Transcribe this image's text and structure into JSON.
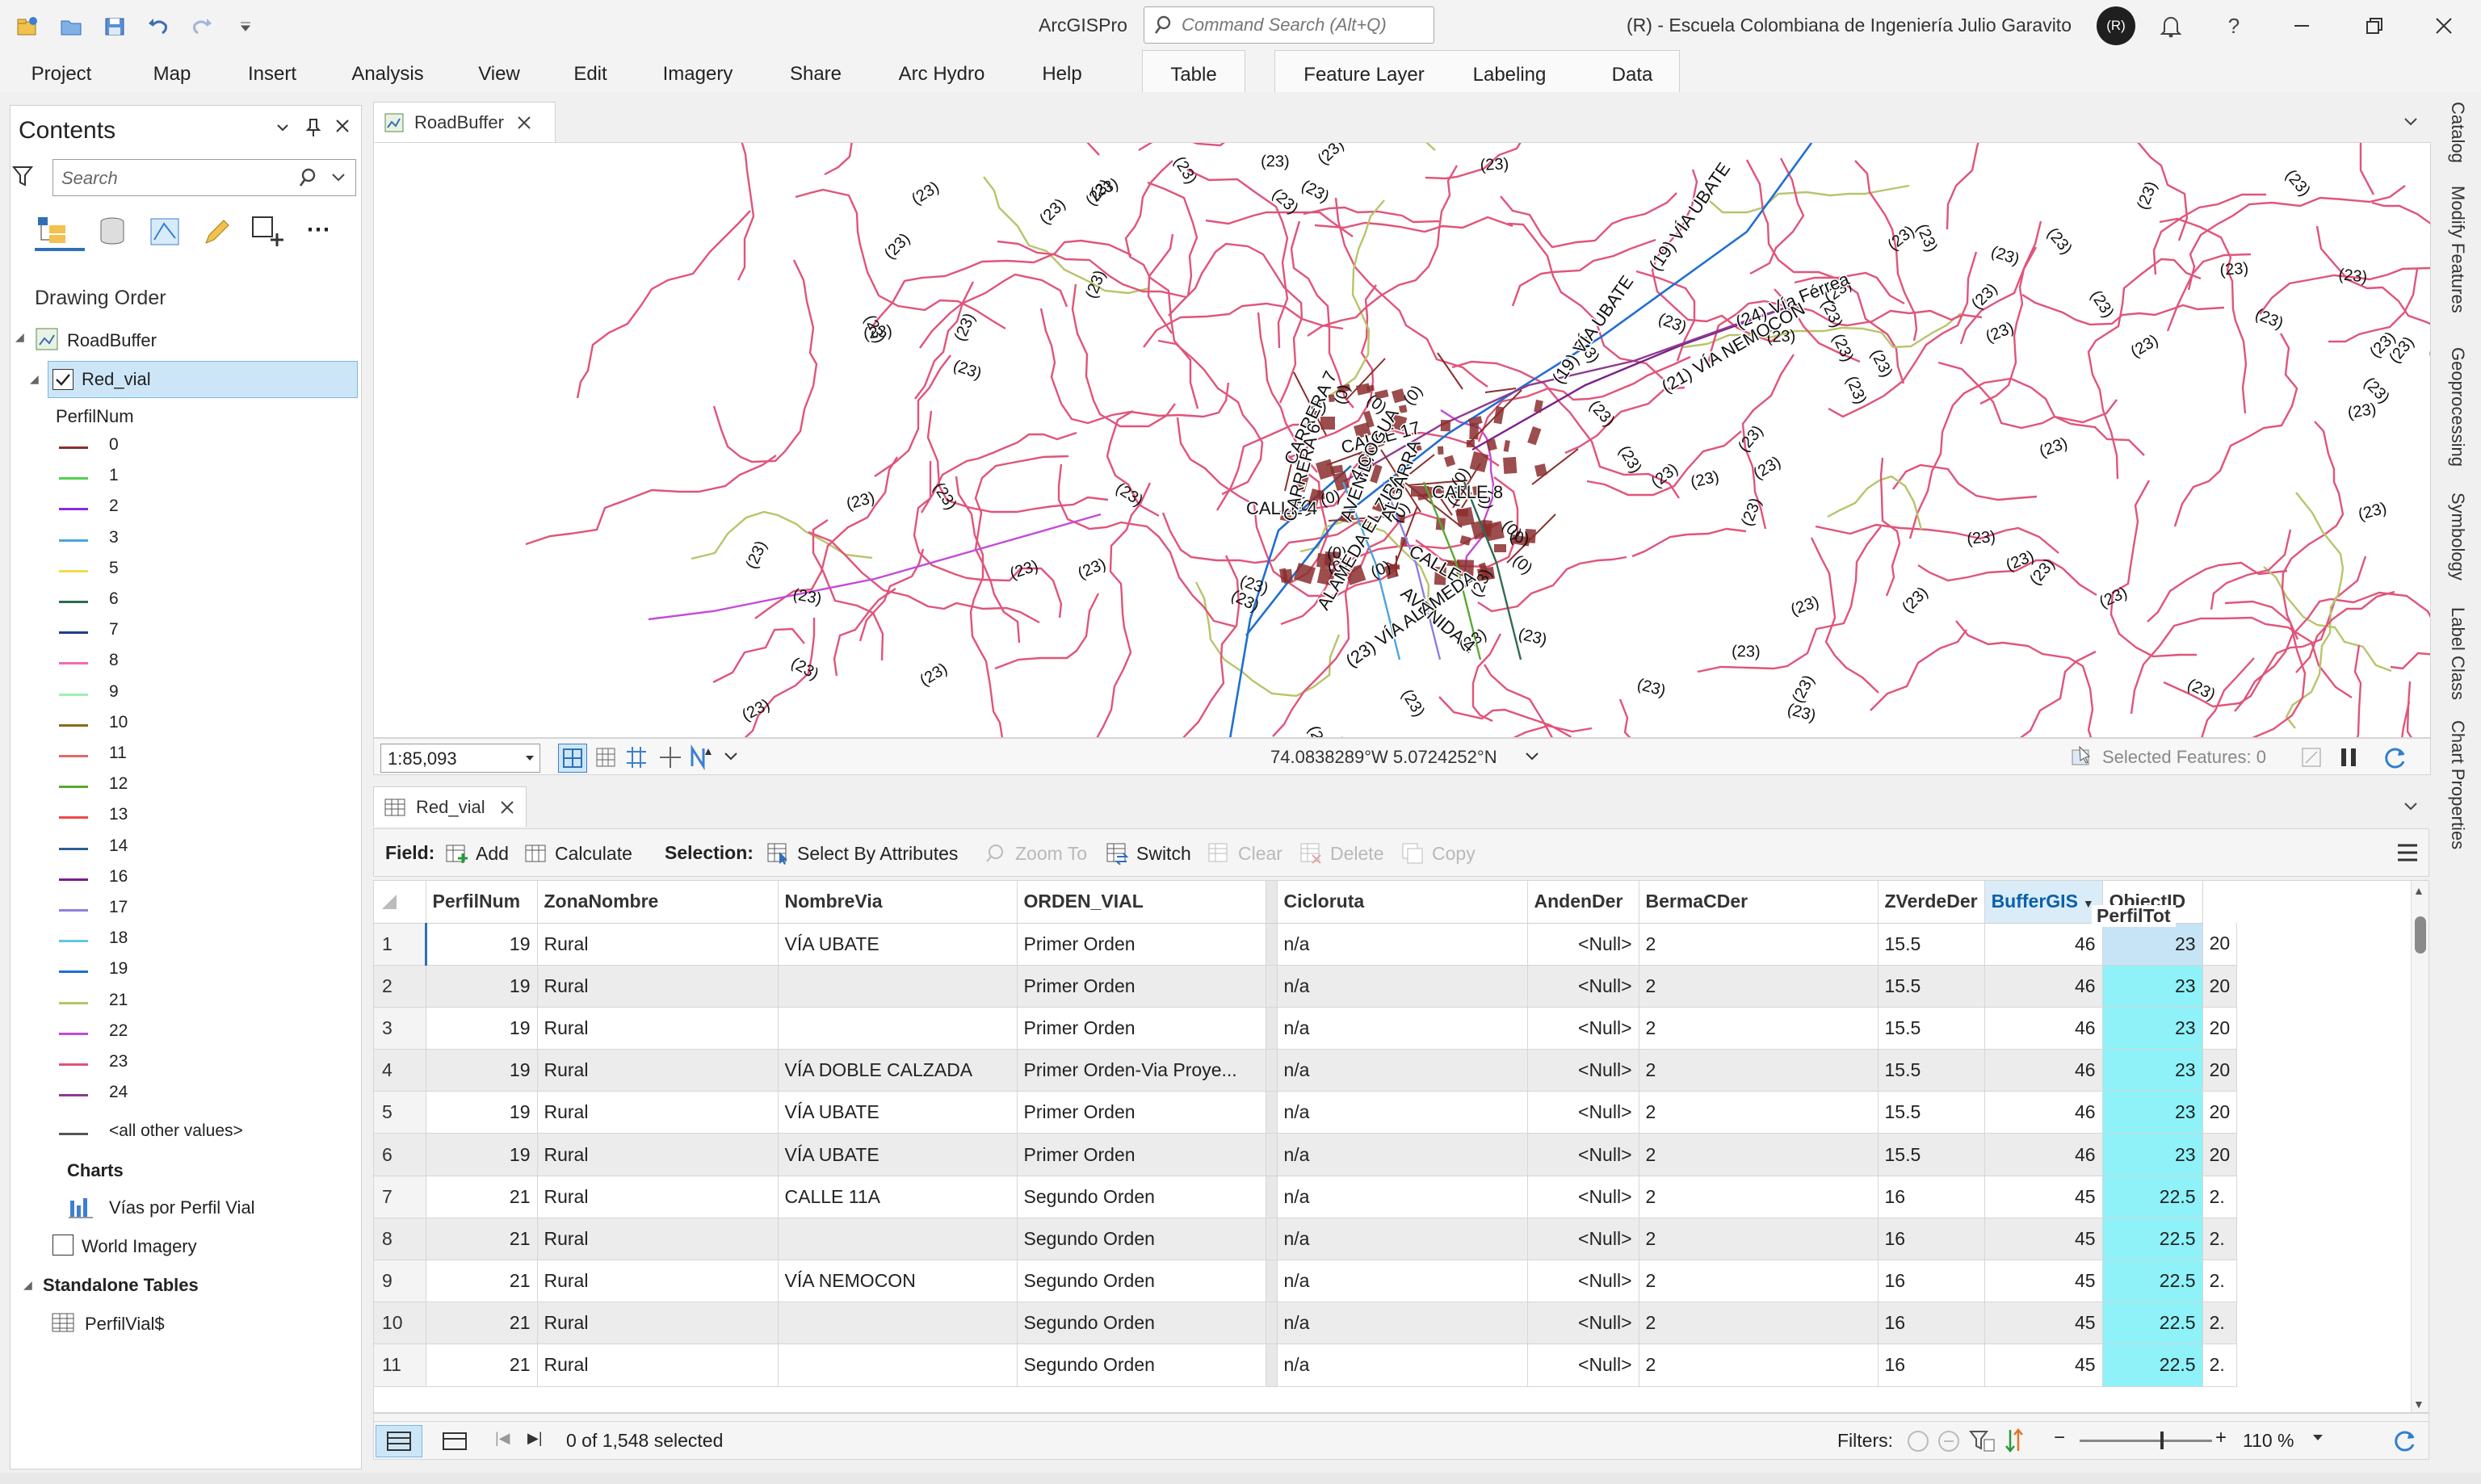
{
  "app": {
    "title": "ArcGISPro",
    "org": "(R) - Escuela Colombiana de Ingeniería Julio Garavito",
    "avatar": "(R)"
  },
  "command_search": {
    "placeholder": "Command Search (Alt+Q)"
  },
  "menu": [
    "Project",
    "Map",
    "Insert",
    "Analysis",
    "View",
    "Edit",
    "Imagery",
    "Share",
    "Arc Hydro",
    "Help"
  ],
  "context_tabs": {
    "group1": [
      "Table"
    ],
    "group2": [
      "Feature Layer",
      "Labeling",
      "Data"
    ]
  },
  "contents": {
    "title": "Contents",
    "search_placeholder": "Search",
    "drawing_order": "Drawing Order",
    "map_name": "RoadBuffer",
    "layer": "Red_vial",
    "field": "PerfilNum",
    "legend": [
      {
        "label": "0",
        "color": "#8b2e2e"
      },
      {
        "label": "1",
        "color": "#4fd14f"
      },
      {
        "label": "2",
        "color": "#8a2be2"
      },
      {
        "label": "3",
        "color": "#4aa3df"
      },
      {
        "label": "5",
        "color": "#f2d94e"
      },
      {
        "label": "6",
        "color": "#2e6b4f"
      },
      {
        "label": "7",
        "color": "#1e3d8f"
      },
      {
        "label": "8",
        "color": "#f06bb5"
      },
      {
        "label": "9",
        "color": "#9ef0b0"
      },
      {
        "label": "10",
        "color": "#8a6a1c"
      },
      {
        "label": "11",
        "color": "#e06a6a"
      },
      {
        "label": "12",
        "color": "#5aa832"
      },
      {
        "label": "13",
        "color": "#f04848"
      },
      {
        "label": "14",
        "color": "#2c5f8f"
      },
      {
        "label": "16",
        "color": "#7a1f8a"
      },
      {
        "label": "17",
        "color": "#8f7fe0"
      },
      {
        "label": "18",
        "color": "#5ec6e6"
      },
      {
        "label": "19",
        "color": "#1f6fd1"
      },
      {
        "label": "21",
        "color": "#b8c46a"
      },
      {
        "label": "22",
        "color": "#c44ad8"
      },
      {
        "label": "23",
        "color": "#e0547a"
      },
      {
        "label": "24",
        "color": "#8e3a8e"
      }
    ],
    "other_values": "<all other values>",
    "other_color": "#555555",
    "charts_heading": "Charts",
    "chart_item": "Vías por Perfil Vial",
    "world_imagery": "World Imagery",
    "standalone_heading": "Standalone Tables",
    "standalone_table": "PerfilVial$"
  },
  "map": {
    "tab": "RoadBuffer",
    "scale": "1:85,093",
    "coords": "74.0838289°W 5.0724252°N",
    "selected_features": "Selected Features: 0",
    "labels": [
      {
        "text": "(19) VÍA UBATE",
        "rot": -55
      },
      {
        "text": "(19) VÍA UBATE",
        "rot": -55
      },
      {
        "text": "(24) Vía Férrea",
        "rot": -22
      },
      {
        "text": "(21) VÍA NEMOCON",
        "rot": -30
      },
      {
        "text": "CARRERA 7",
        "rot": -65
      },
      {
        "text": "CALLE 17",
        "rot": -15
      },
      {
        "text": "CALLE 8",
        "rot": 0
      },
      {
        "text": "CALLE 4",
        "rot": 0
      },
      {
        "text": "CALLE 7",
        "rot": 30
      },
      {
        "text": "AVENIDA 4",
        "rot": 40
      },
      {
        "text": "ALAMEDA EL ZIPA",
        "rot": -60
      },
      {
        "text": "(23) VÍA ALAMEDA",
        "rot": -35
      },
      {
        "text": "ALGARRA",
        "rot": -70
      },
      {
        "text": "AVENIDA",
        "rot": -70
      },
      {
        "text": "CARRERA 6",
        "rot": -75
      },
      {
        "text": "4 COGUA",
        "rot": -60
      }
    ]
  },
  "table": {
    "tab": "Red_vial",
    "field_label": "Field:",
    "add": "Add",
    "calculate": "Calculate",
    "selection_label": "Selection:",
    "select_by_attributes": "Select By Attributes",
    "zoom_to": "Zoom To",
    "switch": "Switch",
    "clear": "Clear",
    "delete": "Delete",
    "copy": "Copy",
    "columns": [
      "PerfilNum",
      "ZonaNombre",
      "NombreVia",
      "ORDEN_VIAL",
      "Cicloruta",
      "AndenDer",
      "BermaCDer",
      "ZVerdeDer",
      "PerfilTot",
      "BufferGIS",
      "ObjectID"
    ],
    "rows": [
      [
        "1",
        "19",
        "Rural",
        "VÍA UBATE",
        "Primer Orden",
        "n/a",
        "<Null>",
        "2",
        "15.5",
        "46",
        "23",
        "20"
      ],
      [
        "2",
        "19",
        "Rural",
        "",
        "Primer Orden",
        "n/a",
        "<Null>",
        "2",
        "15.5",
        "46",
        "23",
        "20"
      ],
      [
        "3",
        "19",
        "Rural",
        "",
        "Primer Orden",
        "n/a",
        "<Null>",
        "2",
        "15.5",
        "46",
        "23",
        "20"
      ],
      [
        "4",
        "19",
        "Rural",
        "VÍA DOBLE CALZADA",
        "Primer Orden-Via Proye...",
        "n/a",
        "<Null>",
        "2",
        "15.5",
        "46",
        "23",
        "20"
      ],
      [
        "5",
        "19",
        "Rural",
        "VÍA UBATE",
        "Primer Orden",
        "n/a",
        "<Null>",
        "2",
        "15.5",
        "46",
        "23",
        "20"
      ],
      [
        "6",
        "19",
        "Rural",
        "VÍA UBATE",
        "Primer Orden",
        "n/a",
        "<Null>",
        "2",
        "15.5",
        "46",
        "23",
        "20"
      ],
      [
        "7",
        "21",
        "Rural",
        "CALLE 11A",
        "Segundo Orden",
        "n/a",
        "<Null>",
        "2",
        "16",
        "45",
        "22.5",
        "2."
      ],
      [
        "8",
        "21",
        "Rural",
        "",
        "Segundo Orden",
        "n/a",
        "<Null>",
        "2",
        "16",
        "45",
        "22.5",
        "2."
      ],
      [
        "9",
        "21",
        "Rural",
        "VÍA NEMOCON",
        "Segundo Orden",
        "n/a",
        "<Null>",
        "2",
        "16",
        "45",
        "22.5",
        "2."
      ],
      [
        "10",
        "21",
        "Rural",
        "",
        "Segundo Orden",
        "n/a",
        "<Null>",
        "2",
        "16",
        "45",
        "22.5",
        "2."
      ],
      [
        "11",
        "21",
        "Rural",
        "",
        "Segundo Orden",
        "n/a",
        "<Null>",
        "2",
        "16",
        "45",
        "22.5",
        "2."
      ]
    ],
    "selected_count": "0 of 1,548 selected",
    "filters_label": "Filters:",
    "zoom": "110 %"
  },
  "right_tabs": [
    "Catalog",
    "Modify Features",
    "Geoprocessing",
    "Symbology",
    "Label Class",
    "Chart Properties"
  ]
}
